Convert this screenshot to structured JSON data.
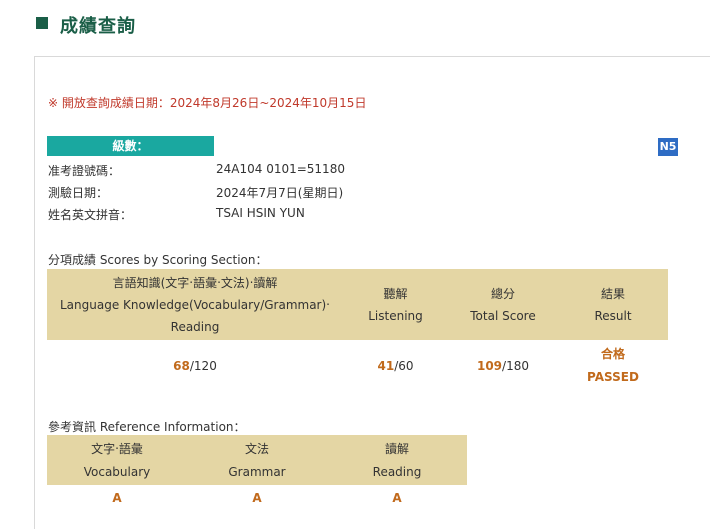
{
  "page": {
    "title": "成績查詢"
  },
  "notice": "※ 開放查詢成績日期：2024年8月26日~2024年10月15日",
  "exam": {
    "level_label": "級數：",
    "level_value": "N5",
    "info": [
      {
        "label": "准考證號碼：",
        "value": "24A104 0101=51180"
      },
      {
        "label": "測驗日期：",
        "value": "2024年7月7日(星期日)"
      },
      {
        "label": "姓名英文拼音：",
        "value": "TSAI HSIN YUN"
      }
    ]
  },
  "scores": {
    "heading": "分項成績 Scores by Scoring Section：",
    "columns": [
      {
        "zh": "言語知識(文字‧語彙‧文法)‧讀解",
        "en1": "Language Knowledge(Vocabulary/Grammar)‧",
        "en2": "Reading"
      },
      {
        "zh": "聽解",
        "en": "Listening"
      },
      {
        "zh": "總分",
        "en": "Total Score"
      },
      {
        "zh": "結果",
        "en": "Result"
      }
    ],
    "row": {
      "language_knowledge": {
        "score": "68",
        "max": "/120"
      },
      "listening": {
        "score": "41",
        "max": "/60"
      },
      "total": {
        "score": "109",
        "max": "/180"
      },
      "result_zh": "合格",
      "result_en": "PASSED"
    }
  },
  "reference": {
    "heading": "參考資訊 Reference Information：",
    "columns": [
      {
        "zh": "文字‧語彙",
        "en": "Vocabulary",
        "grade": "A"
      },
      {
        "zh": "文法",
        "en": "Grammar",
        "grade": "A"
      },
      {
        "zh": "讀解",
        "en": "Reading",
        "grade": "A"
      }
    ]
  }
}
